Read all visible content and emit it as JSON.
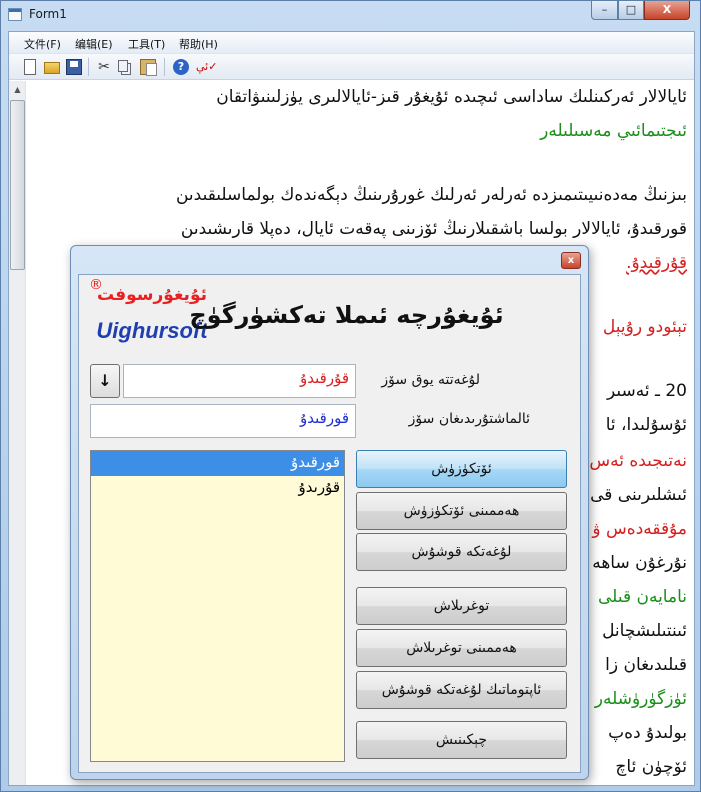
{
  "window": {
    "title": "Form1",
    "minimize": "–",
    "maximize": "□",
    "close": "X"
  },
  "menubar": {
    "items": [
      "文件(F)",
      "编辑(E)",
      "工具(T)",
      "帮助(H)"
    ]
  },
  "toolbar": {
    "icons": [
      "new-file-icon",
      "open-folder-icon",
      "save-icon",
      "cut-icon",
      "copy-icon",
      "paste-icon",
      "help-icon",
      "spell-check-icon"
    ],
    "help_glyph": "?",
    "spell_glyph": "ئې✓"
  },
  "document": {
    "lines": [
      "ئايالالار ئەركىنلىك ساداسى ئىچىدە ئۇيغۇر قىز-ئايالالىرى يۈزلىنىۋاتقان",
      "ئىجتىمائىي مەسىلىلەر",
      "بىزنىڭ مەدەنىيىتىمىزدە ئەرلەر ئەرلىك غورۇرىنىڭ دېگەندەك بولماسلىقىدىن",
      "قورقىدۇ، ئايالالار بولسا باشقىلارنىڭ ئۆزىنى پەقەت ئايال، دەپلا قارىشىدىن",
      "قۇرقىدۇ.",
      "تېئودو رۇيېل",
      "20 ـ ئەسىر",
      "ئۇسۇلىدا، ئا",
      "نەتىجىدە ئەس",
      "ئىشلىرىنى قى",
      "مۇققەدەس ۋ",
      "نۇرغۇن ساھە",
      "نامايەن قىلى",
      "ئىنتىلىشچانل",
      "قىلىدىغان زا",
      "ئۈزگۈرۈشلەر",
      "بولىدۇ دەپ",
      "ئۆچۈن ئاچ"
    ]
  },
  "dialog": {
    "close": "x",
    "title": "ئۇيغۇرچە ئىملا تەكشۈرگۈچ",
    "logo_ug": "ئۇيغۇرسوفت",
    "logo_reg": "®",
    "logo_en": "Uighursoft",
    "wrong_label": "لۇغەتتە يوق سۆز",
    "wrong_value": "قۇرقىدۇ",
    "replace_label": "ئالماشتۇرىدىغان سۆز",
    "replace_value": "قورقىدۇ",
    "arrow": "↓",
    "suggestions": [
      "قورقىدۇ",
      "قۇرىدۇ"
    ],
    "buttons": {
      "ignore": "ئۆتكۈزۈش",
      "ignore_all": "ھەممىنى ئۆتكۈزۈش",
      "add": "لۇغەتكە قوشۇش",
      "change": "توغرىلاش",
      "change_all": "ھەممىنى توغرىلاش",
      "autocorrect": "ئاپتوماتىك لۇغەتكە قوشۇش",
      "cancel": "چېكىنىش"
    }
  },
  "colors": {
    "wrong_word": "#d61f1f",
    "replace_word": "#1f2fd0",
    "listbox_bg": "#fffbd6",
    "selection": "#3d8ee6"
  }
}
